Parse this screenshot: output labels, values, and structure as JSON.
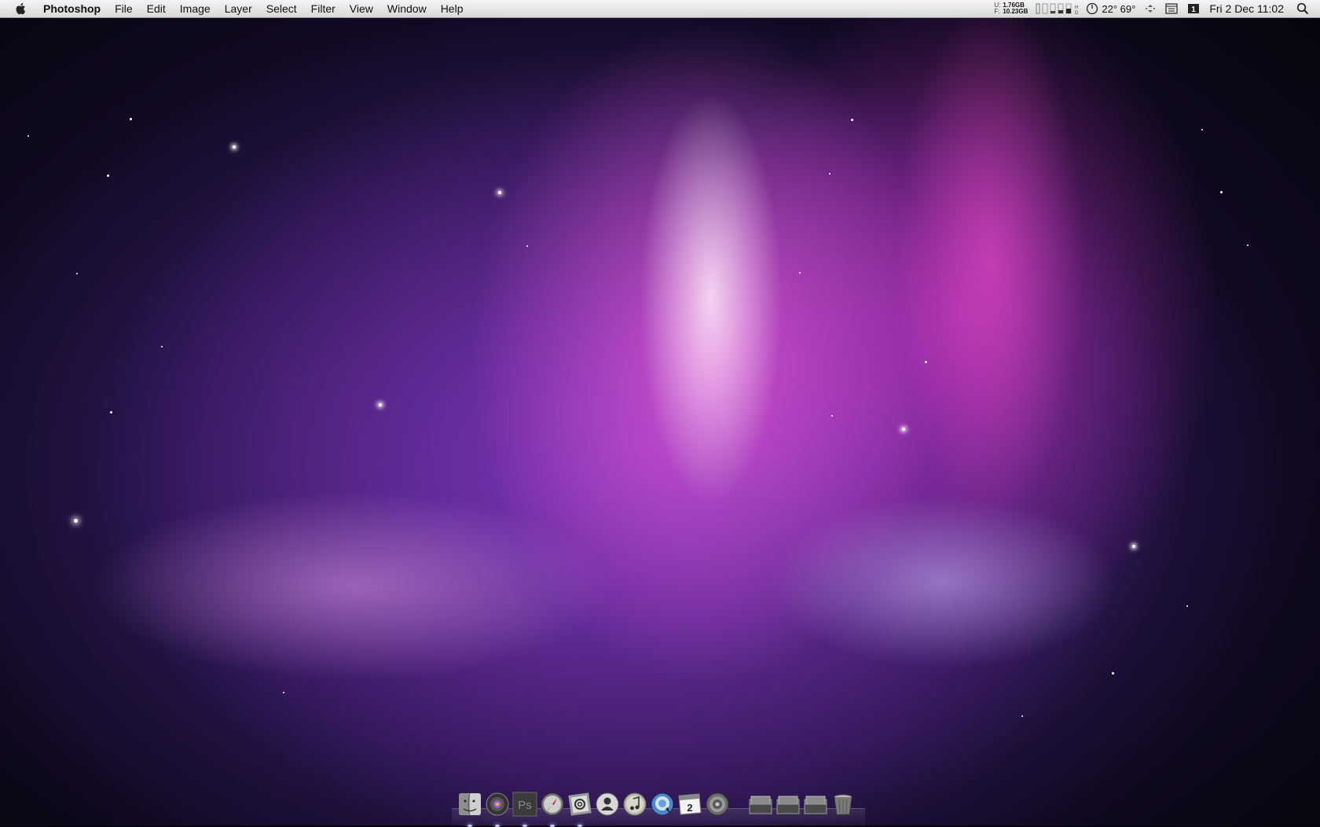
{
  "menubar": {
    "app_name": "Photoshop",
    "menus": [
      "File",
      "Edit",
      "Image",
      "Layer",
      "Select",
      "Filter",
      "View",
      "Window",
      "Help"
    ],
    "memory": {
      "used_key": "U:",
      "used_value": "1.76GB",
      "free_key": "F:",
      "free_value": "10.23GB"
    },
    "temperature": "22° 69°",
    "datetime": "Fri 2 Dec  11:02"
  },
  "dock": {
    "apps": [
      {
        "name": "Finder",
        "running": true
      },
      {
        "name": "iTunes-like player",
        "running": true
      },
      {
        "name": "Photoshop",
        "running": true,
        "label": "Ps"
      },
      {
        "name": "Safari",
        "running": true
      },
      {
        "name": "Mail",
        "running": true
      },
      {
        "name": "Address Book",
        "running": false
      },
      {
        "name": "iTunes",
        "running": false
      },
      {
        "name": "iChat",
        "running": false
      },
      {
        "name": "iCal",
        "running": false,
        "label": "2"
      },
      {
        "name": "System Preferences",
        "running": false
      }
    ],
    "folders": [
      "Folder 1",
      "Folder 2",
      "Folder 3"
    ],
    "trash": "Trash"
  }
}
